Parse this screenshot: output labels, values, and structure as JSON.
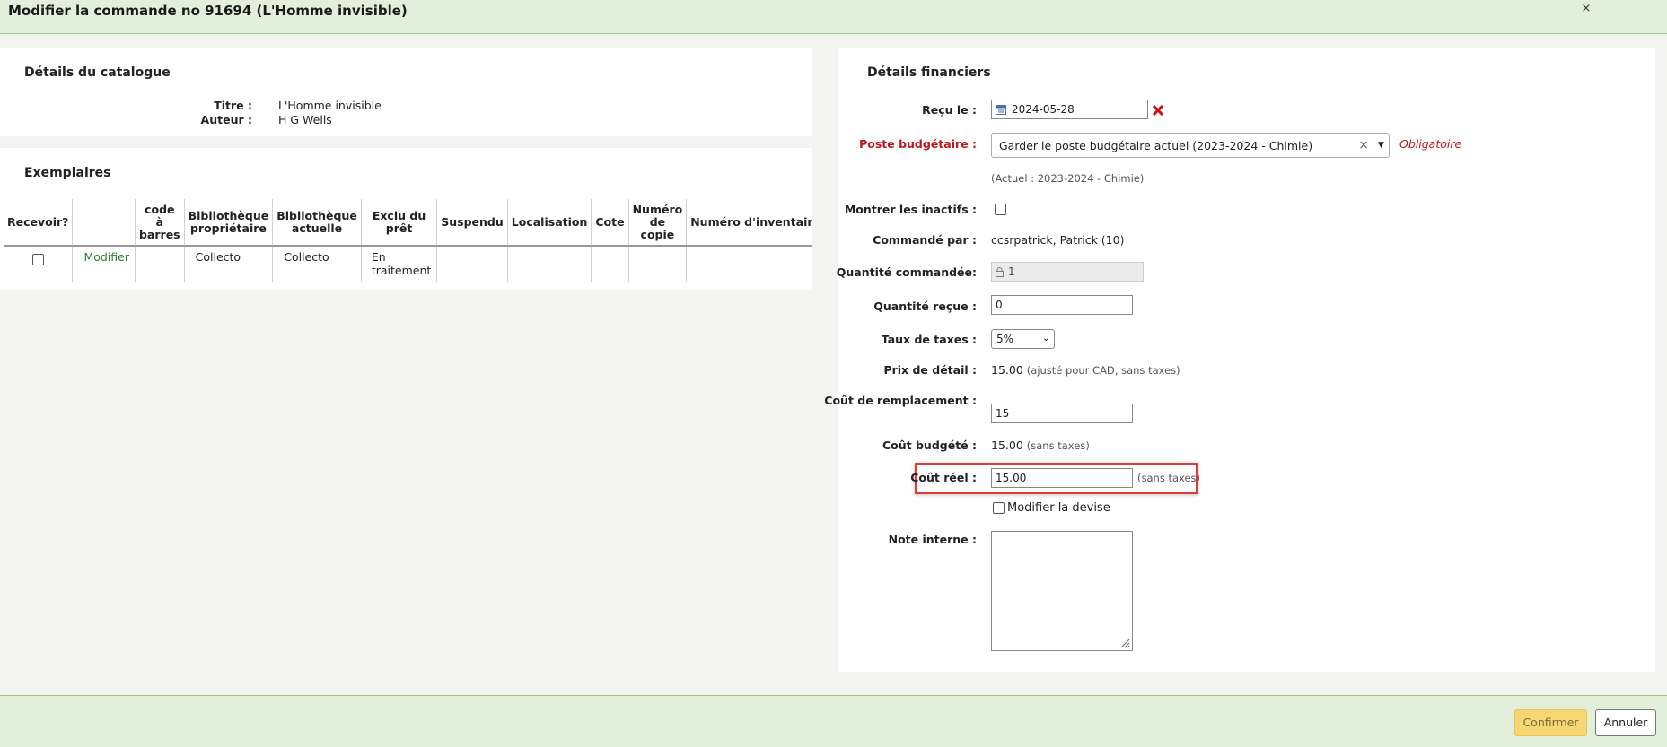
{
  "modal": {
    "title": "Modifier la commande no 91694 (L'Homme invisible)",
    "close_label": "×"
  },
  "catalog": {
    "heading": "Détails du catalogue",
    "title_label": "Titre :",
    "title_value": "L'Homme invisible",
    "author_label": "Auteur :",
    "author_value": "H G Wells"
  },
  "items": {
    "heading": "Exemplaires",
    "columns": [
      "Recevoir?",
      "",
      "code à barres",
      "Bibliothèque propriétaire",
      "Bibliothèque actuelle",
      "Exclu du prêt",
      "Suspendu",
      "Localisation",
      "Cote",
      "Numéro de copie",
      "Numéro d'inventaire"
    ],
    "rows": [
      {
        "receive_checked": false,
        "edit_label": "Modifier",
        "barcode": "",
        "home_library": "Collecto",
        "current_library": "Collecto",
        "not_for_loan": "En traitement",
        "suspended": "",
        "location": "",
        "call_number": "",
        "copy_number": "",
        "inventory_number": ""
      }
    ]
  },
  "financial": {
    "heading": "Détails financiers",
    "received_label": "Reçu le :",
    "received_date": "2024-05-28",
    "fund_label": "Poste budgétaire :",
    "fund_value": "Garder le poste budgétaire actuel (2023-2024 - Chimie)",
    "fund_required": "Obligatoire",
    "fund_current": "(Actuel : 2023-2024 - Chimie)",
    "show_inactive_label": "Montrer les inactifs :",
    "ordered_by_label": "Commandé par :",
    "ordered_by_value": "ccsrpatrick, Patrick (10)",
    "qty_ordered_label": "Quantité commandée:",
    "qty_ordered_value": "1",
    "qty_received_label": "Quantité reçue :",
    "qty_received_value": "0",
    "tax_label": "Taux de taxes :",
    "tax_value": "5%",
    "retail_label": "Prix de détail :",
    "retail_value": "15.00",
    "retail_note": "(ajusté pour CAD, sans taxes)",
    "replacement_label": "Coût de remplacement :",
    "replacement_value": "15",
    "budgeted_label": "Coût budgété :",
    "budgeted_value": "15.00",
    "budgeted_note": "(sans taxes)",
    "actual_label": "Coût réel :",
    "actual_value": "15.00",
    "actual_note": "(sans taxes)",
    "change_currency_label": "Modifier la devise",
    "note_label": "Note interne :"
  },
  "footer": {
    "confirm_label": "Confirmer",
    "cancel_label": "Annuler"
  },
  "colors": {
    "header_bg": "#e2efda",
    "required_red": "#c0141a",
    "link_green": "#2e7d32",
    "confirm_bg": "#f7d774",
    "highlight_red": "#e53935"
  }
}
